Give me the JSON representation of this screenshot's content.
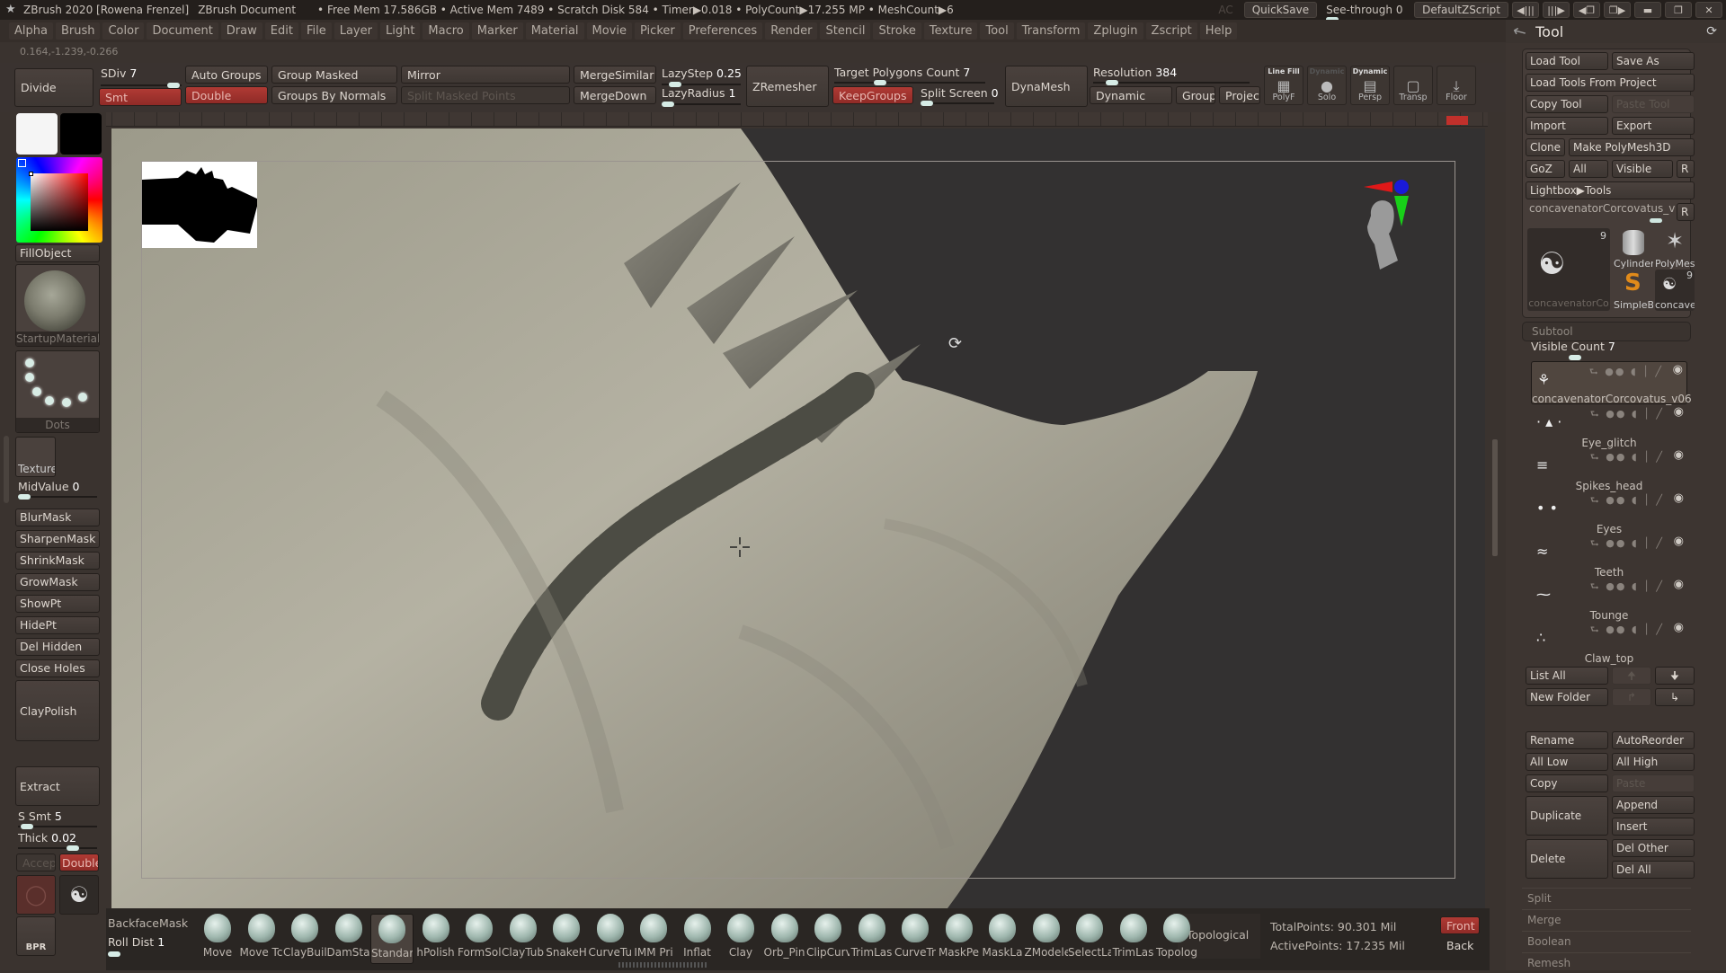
{
  "titlebar": {
    "app": "ZBrush 2020 [Rowena Frenzel]",
    "document": "ZBrush Document",
    "stats": "• Free Mem 17.586GB • Active Mem 7489 • Scratch Disk 584 •  Timer▶0.018 • PolyCount▶17.255 MP  • MeshCount▶6",
    "ac": "AC",
    "quicksave": "QuickSave",
    "see_through_label": "See-through",
    "see_through_value": "0",
    "default_zscript": "DefaultZScript"
  },
  "menu": [
    "Alpha",
    "Brush",
    "Color",
    "Document",
    "Draw",
    "Edit",
    "File",
    "Layer",
    "Light",
    "Macro",
    "Marker",
    "Material",
    "Movie",
    "Picker",
    "Preferences",
    "Render",
    "Stencil",
    "Stroke",
    "Texture",
    "Tool",
    "Transform",
    "Zplugin",
    "Zscript",
    "Help"
  ],
  "coords": "0.164,-1.239,-0.266",
  "shelf": {
    "divide": "Divide",
    "sdiv_label": "SDiv",
    "sdiv_value": "7",
    "smt": "Smt",
    "auto_groups": "Auto Groups",
    "double": "Double",
    "group_masked": "Group Masked",
    "groups_by_normals": "Groups By Normals",
    "mirror": "Mirror",
    "split_masked_points": "Split Masked Points",
    "merge_similar": "MergeSimilar",
    "merge_down": "MergeDown",
    "lazystep_label": "LazyStep",
    "lazystep_value": "0.25",
    "lazyradius_label": "LazyRadius",
    "lazyradius_value": "1",
    "zremesher": "ZRemesher",
    "target_polys_label": "Target Polygons Count",
    "target_polys_value": "7",
    "keepgroups": "KeepGroups",
    "split_screen_label": "Split Screen",
    "split_screen_value": "0",
    "dynamesh": "DynaMesh",
    "resolution_label": "Resolution",
    "resolution_value": "384",
    "dynamic": "Dynamic",
    "groups": "Groups",
    "project": "Project",
    "polyf_top": "Line Fill",
    "polyf": "PolyF",
    "solo_top": "Dynamic",
    "solo": "Solo",
    "persp_top": "Dynamic",
    "persp": "Persp",
    "transp": "Transp",
    "floor": "Floor"
  },
  "lefttray": {
    "fill_object": "FillObject",
    "material": "StartupMaterial",
    "stroke": "Dots",
    "texture": "Texture",
    "midvalue_label": "MidValue",
    "midvalue_value": "0",
    "buttons": [
      "BlurMask",
      "SharpenMask",
      "ShrinkMask",
      "GrowMask",
      "ShowPt",
      "HidePt",
      "Del Hidden",
      "Close Holes"
    ],
    "claypolish": "ClayPolish",
    "extract": "Extract",
    "ssmt_label": "S Smt",
    "ssmt_value": "5",
    "thick_label": "Thick",
    "thick_value": "0.02",
    "accept": "Accept",
    "double": "Double",
    "bpr": "BPR"
  },
  "tool": {
    "title": "Tool",
    "load_tool": "Load Tool",
    "save_as": "Save As",
    "load_from_project": "Load Tools From Project",
    "copy_tool": "Copy Tool",
    "paste_tool": "Paste Tool",
    "import": "Import",
    "export": "Export",
    "clone": "Clone",
    "make_polymesh": "Make PolyMesh3D",
    "goz": "GoZ",
    "all": "All",
    "visible": "Visible",
    "r": "R",
    "lightbox_tools": "Lightbox▶Tools",
    "current_tool": "concavenatorCorcovatus_v06",
    "thumbs": [
      {
        "label": "concavenatorCo",
        "badge": "9"
      },
      {
        "label": "Cylinder"
      },
      {
        "label": "PolyMes"
      },
      {
        "label": "SimpleB"
      },
      {
        "label": "concave",
        "badge": "9"
      }
    ]
  },
  "subtool": {
    "title": "Subtool",
    "visible_count_label": "Visible Count",
    "visible_count_value": "7",
    "items": [
      {
        "name": "concavenatorCorcovatus_v06",
        "selected": true
      },
      {
        "name": "Eye_glitch"
      },
      {
        "name": "Spikes_head"
      },
      {
        "name": "Eyes"
      },
      {
        "name": "Teeth"
      },
      {
        "name": "Tounge"
      },
      {
        "name": "Claw_top"
      }
    ],
    "list_all": "List All",
    "new_folder": "New Folder",
    "rename": "Rename",
    "auto_reorder": "AutoReorder",
    "all_low": "All Low",
    "all_high": "All High",
    "copy": "Copy",
    "paste": "Paste",
    "duplicate": "Duplicate",
    "append": "Append",
    "insert": "Insert",
    "delete": "Delete",
    "del_other": "Del Other",
    "del_all": "Del All",
    "sections": [
      "Split",
      "Merge",
      "Boolean",
      "Remesh"
    ]
  },
  "bottom": {
    "backface_mask": "BackfaceMask",
    "roll_dist_label": "Roll Dist",
    "roll_dist_value": "1",
    "brushes": [
      "Move",
      "Move Tc",
      "ClayBuil",
      "DamSta",
      "Standar",
      "hPolish",
      "FormSol",
      "ClayTub",
      "SnakeH",
      "CurveTu",
      "IMM Pri",
      "Inflat",
      "Clay",
      "Orb_Pin",
      "ClipCurv",
      "TrimLas",
      "CurveTr",
      "MaskPe",
      "MaskLa",
      "ZModele",
      "SelectLa",
      "TrimLas",
      "Topolog"
    ],
    "selected_brush": "Standar",
    "topological": "Topological",
    "total_points": "TotalPoints: 90.301 Mil",
    "active_points": "ActivePoints: 17.235 Mil",
    "front": "Front",
    "back": "Back"
  }
}
